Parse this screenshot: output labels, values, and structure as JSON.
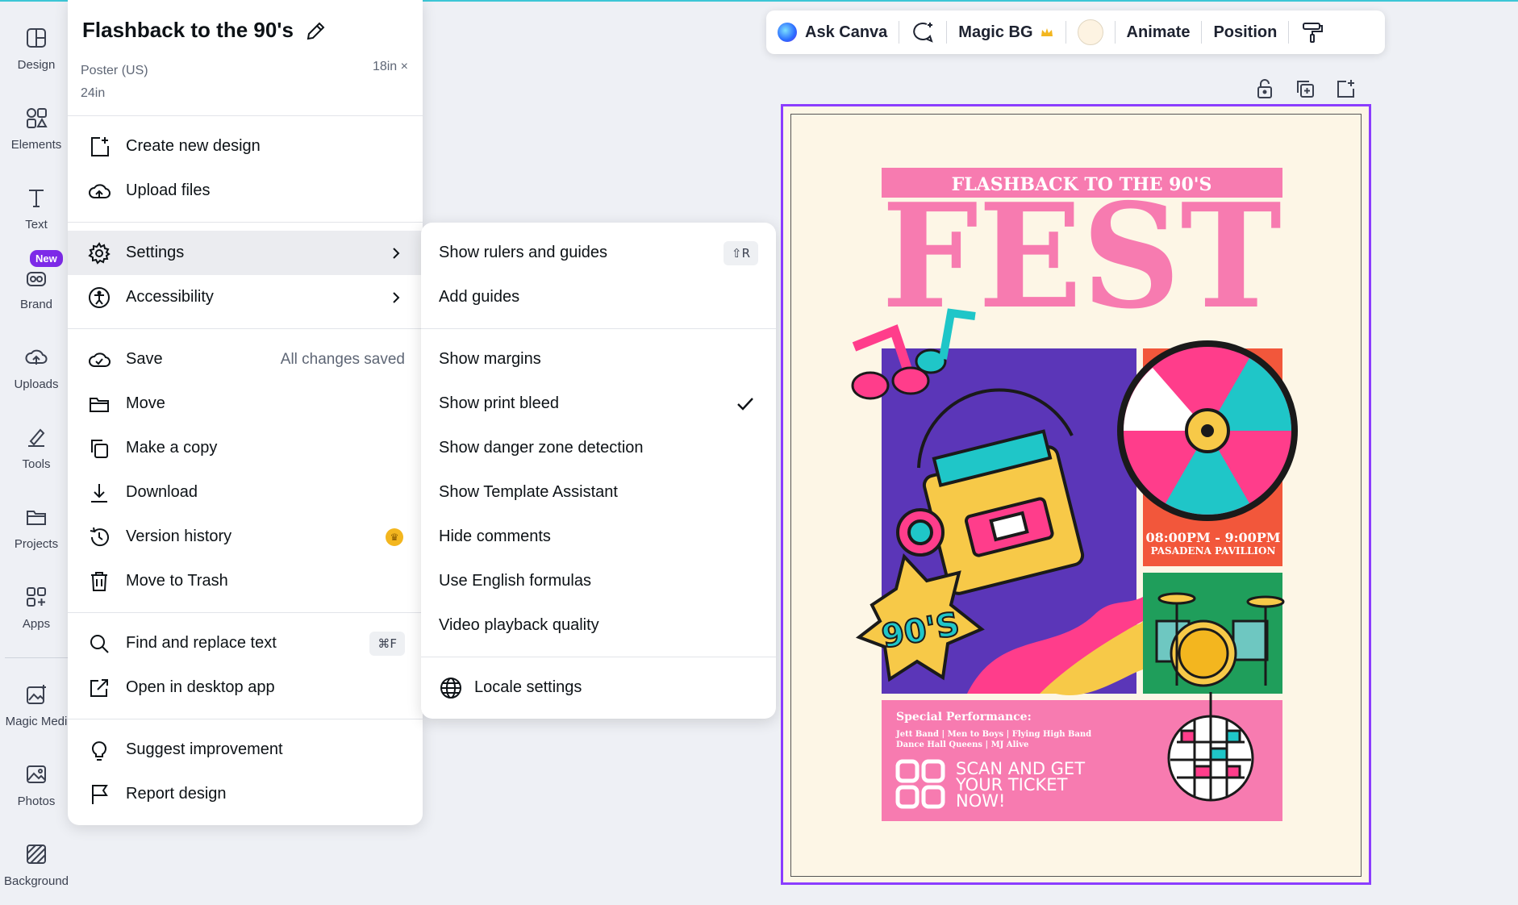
{
  "rail": [
    {
      "label": "Design",
      "icon": "design-icon"
    },
    {
      "label": "Elements",
      "icon": "elements-icon"
    },
    {
      "label": "Text",
      "icon": "text-icon"
    },
    {
      "label": "Brand",
      "icon": "brand-icon",
      "badge": "New"
    },
    {
      "label": "Uploads",
      "icon": "uploads-icon"
    },
    {
      "label": "Tools",
      "icon": "tools-icon"
    },
    {
      "label": "Projects",
      "icon": "projects-icon"
    },
    {
      "label": "Apps",
      "icon": "apps-icon"
    },
    {
      "label": "Magic Medi",
      "icon": "magic-media-icon"
    },
    {
      "label": "Photos",
      "icon": "photos-icon"
    },
    {
      "label": "Background",
      "icon": "background-icon"
    }
  ],
  "menu": {
    "title": "Flashback to the 90's",
    "subtitle_line1": "Poster (US)",
    "subtitle_line2": "24in",
    "size": "18in ×",
    "items": {
      "create": "Create new design",
      "upload": "Upload files",
      "settings": "Settings",
      "accessibility": "Accessibility",
      "save": "Save",
      "save_status": "All changes saved",
      "move": "Move",
      "copy": "Make a copy",
      "download": "Download",
      "version": "Version history",
      "trash": "Move to Trash",
      "find": "Find and replace text",
      "find_kbd": "⌘F",
      "desktop": "Open in desktop app",
      "suggest": "Suggest improvement",
      "report": "Report design"
    }
  },
  "submenu": {
    "rulers": "Show rulers and guides",
    "rulers_kbd": "⇧R",
    "add_guides": "Add guides",
    "margins": "Show margins",
    "bleed": "Show print bleed",
    "danger": "Show danger zone detection",
    "template": "Show Template Assistant",
    "comments": "Hide comments",
    "formulas": "Use English formulas",
    "video": "Video playback quality",
    "locale": "Locale settings"
  },
  "toolbar": {
    "ask": "Ask Canva",
    "magic_bg": "Magic BG",
    "animate": "Animate",
    "position": "Position"
  },
  "poster": {
    "banner": "FLASHBACK TO THE 90'S",
    "headline": "FEST",
    "sticker": "90'S",
    "time": "08:00PM - 9:00PM",
    "venue": "PASADENA PAVILLION",
    "special": "Special Performance:",
    "bands1": "Jett Band | Men to Boys | Flying High Band",
    "bands2": "Dance Hall Queens | MJ Alive",
    "scan1": "SCAN AND GET",
    "scan2": "YOUR TICKET",
    "scan3": "NOW!"
  },
  "colors": {
    "accent": "#8b3dff",
    "pink": "#f77bb0",
    "purple": "#5b36b8",
    "orange": "#f2573b",
    "green": "#1f9e5b",
    "cream": "#fdf6e6"
  }
}
